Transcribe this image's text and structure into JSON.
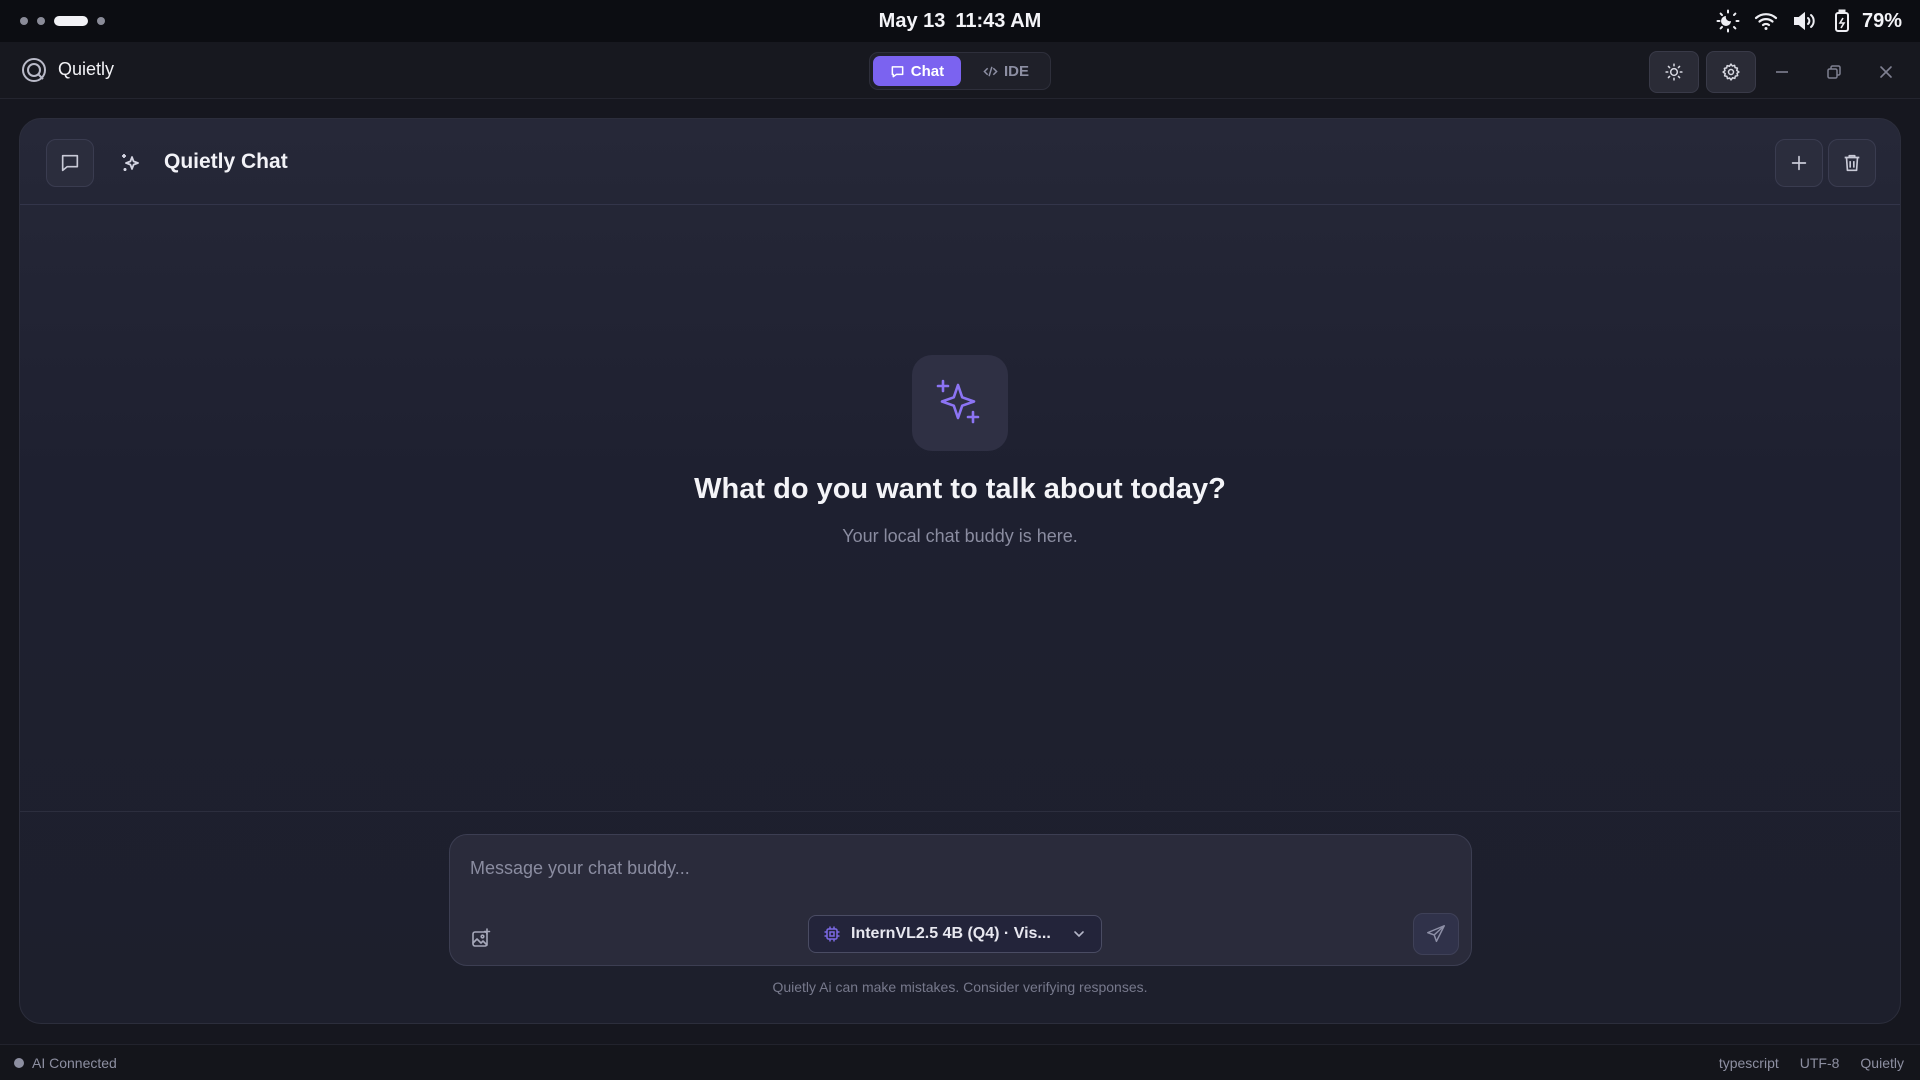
{
  "os": {
    "date": "May 13",
    "time": "11:43 AM",
    "battery": "79%"
  },
  "app": {
    "name": "Quietly",
    "modes": [
      {
        "label": "Chat",
        "active": true
      },
      {
        "label": "IDE",
        "active": false
      }
    ],
    "accent": "#7b63f0"
  },
  "chat": {
    "title": "Quietly Chat",
    "empty_title": "What do you want to talk about today?",
    "empty_subtitle": "Your local chat buddy is here.",
    "input_placeholder": "Message your chat buddy...",
    "model_label": "InternVL2.5 4B (Q4) · Vis...",
    "disclaimer": "Quietly Ai can make mistakes. Consider verifying responses."
  },
  "status": {
    "connection": "AI Connected",
    "language": "typescript",
    "encoding": "UTF-8",
    "app": "Quietly"
  },
  "icons": {
    "workspace": "workspace-dots",
    "night_light": "night-light-icon",
    "wifi": "wifi-icon",
    "volume": "volume-icon",
    "battery": "battery-icon",
    "theme": "sun-icon",
    "settings": "gear-icon",
    "hero": "sparkles-icon"
  }
}
